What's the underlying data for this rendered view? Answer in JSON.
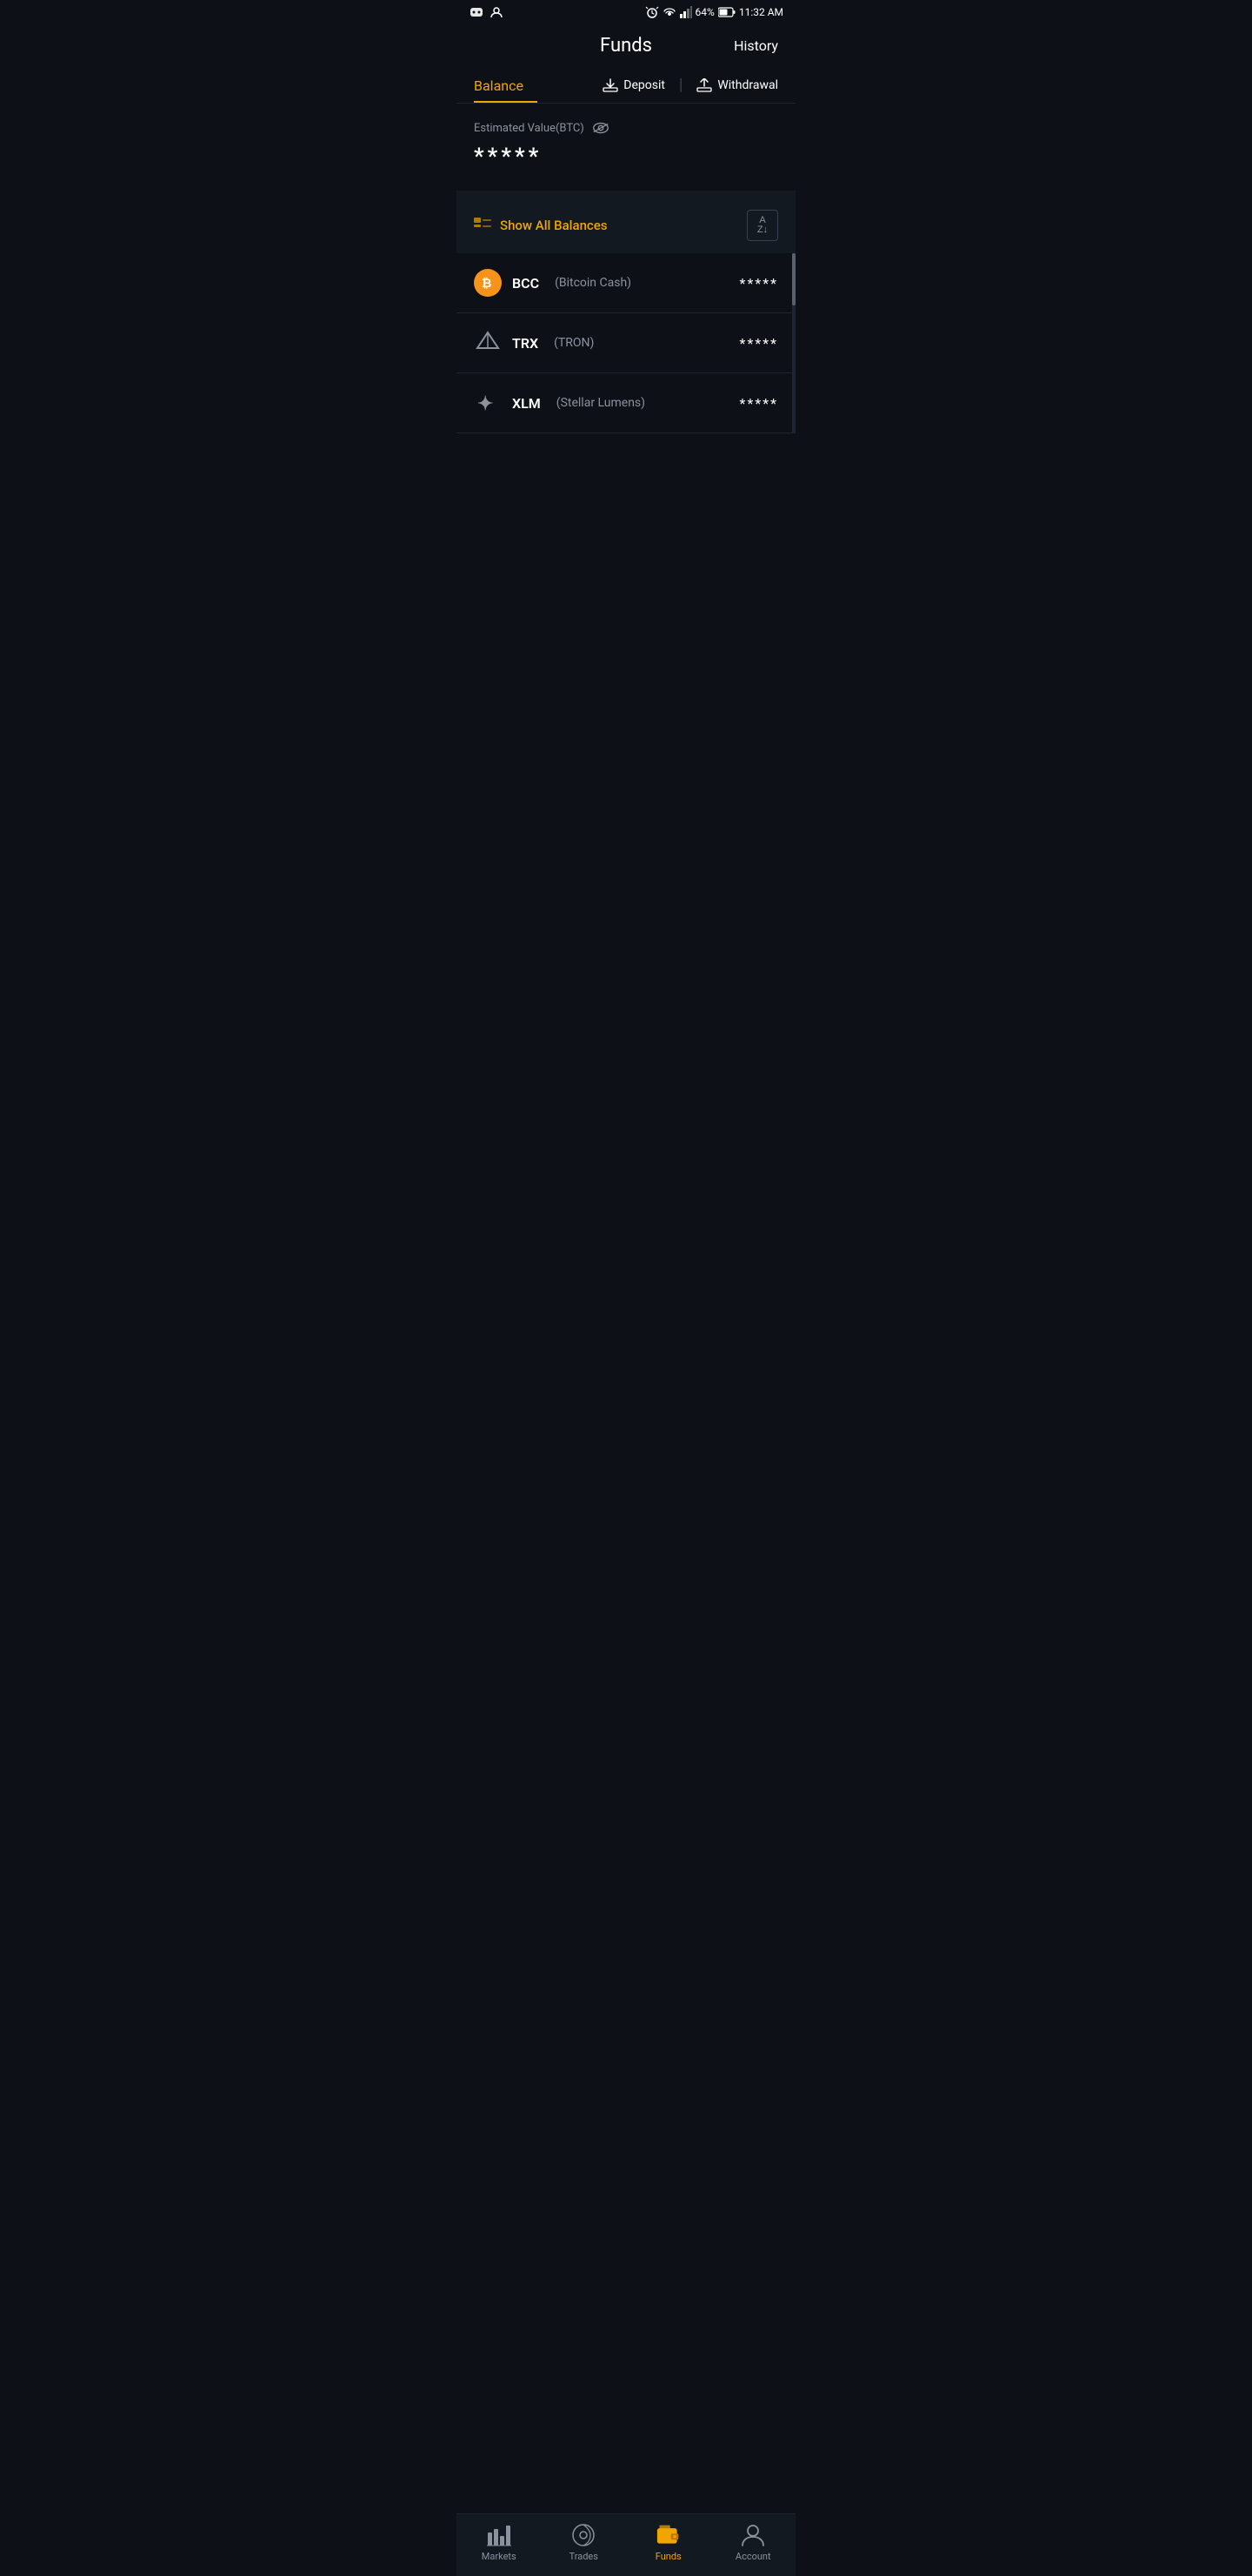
{
  "statusBar": {
    "time": "11:32 AM",
    "battery": "64%",
    "signal": "signal"
  },
  "header": {
    "title": "Funds",
    "historyLabel": "History"
  },
  "tabs": {
    "balance": "Balance",
    "deposit": "Deposit",
    "withdrawal": "Withdrawal"
  },
  "estimatedValue": {
    "label": "Estimated Value(BTC)",
    "value": "*****"
  },
  "balanceSection": {
    "title": "Show All Balances",
    "sortLabel": "A↓Z"
  },
  "coins": [
    {
      "symbol": "BCC",
      "name": "Bitcoin Cash",
      "balance": "*****",
      "iconType": "bcc"
    },
    {
      "symbol": "TRX",
      "name": "TRON",
      "balance": "*****",
      "iconType": "trx"
    },
    {
      "symbol": "XLM",
      "name": "Stellar Lumens",
      "balance": "*****",
      "iconType": "xlm"
    }
  ],
  "bottomNav": {
    "items": [
      {
        "label": "Markets",
        "id": "markets",
        "active": false
      },
      {
        "label": "Trades",
        "id": "trades",
        "active": false
      },
      {
        "label": "Funds",
        "id": "funds",
        "active": true
      },
      {
        "label": "Account",
        "id": "account",
        "active": false
      }
    ]
  },
  "colors": {
    "accent": "#f0a500",
    "background": "#0d1117",
    "secondary": "#131920",
    "text": "#ffffff",
    "subtext": "#8a929e"
  }
}
